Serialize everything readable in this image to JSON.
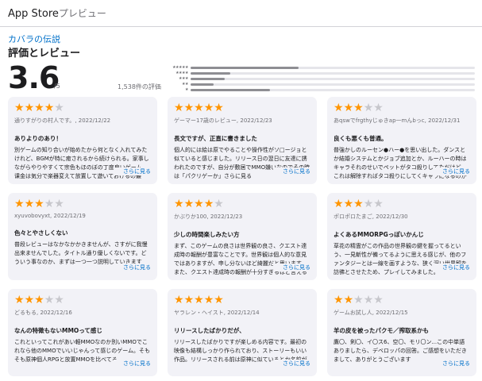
{
  "header": {
    "store": "App Store",
    "preview": "プレビュー"
  },
  "app": {
    "name": "カバラの伝説"
  },
  "ratings": {
    "section_title": "評価とレビュー",
    "score": "3.6",
    "out_of": "/5",
    "count": "1,538件の評価",
    "histogram": [
      {
        "stars": "★★★★★",
        "fraction": 0.38
      },
      {
        "stars": "★★★★",
        "fraction": 0.14
      },
      {
        "stars": "★★★",
        "fraction": 0.12
      },
      {
        "stars": "★★",
        "fraction": 0.08
      },
      {
        "stars": "★",
        "fraction": 0.28
      }
    ]
  },
  "reviews": [
    {
      "rating": 4,
      "author": "通りすがりの村人です。",
      "date": "2022/12/22",
      "title": "ありよりのあり！",
      "body": "別ゲームの知り合いが始めたから何となく入れてみたけれど、BGMが特に癒されるから続けられる。家事しながらやりやすくて宗色もほのぼの丁度良いゲーム。课金は気分で楽器変えて放置して遊いておけるの最高。",
      "more": "さらに見る"
    },
    {
      "rating": 5,
      "author": "ゲーマー17歳のレビュー",
      "date": "2022/12/23",
      "title": "長文ですが、正直に書きました",
      "body": "個人的には絵は原でやることや操作性がソ□ージョと似ていると感じました。リリース日の翌日に友達に誘われたのですが、自分が敷居でMMO嫌いなのでその時は「パクリゲーか」さらに見る",
      "more": "さらに見る"
    },
    {
      "rating": 3,
      "author": "あqswでfrgthyじゅきap一mんbっc",
      "date": "2022/12/31",
      "title": "良くも悪くも普通。",
      "body": "普強かしのルーセン●ハー●を思い出した。ダンスとか結婚システムとかジョブ追加とか、ルーハーの時はキャラそれのせいでペットがタコ殺りしてただけど、これは解除すればタコ殺りにしてくキャラになるのかな、きっと、わかり",
      "more": "さらに見る"
    },
    {
      "rating": 3,
      "author": "xyuvobovyxt",
      "date": "2022/12/19",
      "title": "色々とやさしくない",
      "body": "普段レビューはなかなかかきませんが、さすがに我慢出来ませんでした。タイトル通り優しくないです。どういう事なのか、まずは一つ一つ説明していきます",
      "more": "さらに見る"
    },
    {
      "rating": 4,
      "author": "かぶりか100",
      "date": "2022/12/23",
      "title": "少しの時間楽しみたい方",
      "body": "まず、このゲームの良さは世界観の良さ、クエスト達成時の報酬が豊富なことです。世界観は個人的な意見ではありますが、申し分ないほど綺麗だと思います。また、クエスト達成時の報酬が十分すぎるほど言えるということ",
      "more": "さらに見る"
    },
    {
      "rating": 3,
      "author": "ポロポロたまご",
      "date": "2022/12/30",
      "title": "よくあるMMORPGっぽいかんじ",
      "body": "草花の精霊がこの作品の世界観の鍵を握ってるという、一見斬性が備ってるように思える感じが、他のファンタジーとは一線を画すような、狭く深い世界観を訪彿とさせたため、プレイしてみました。",
      "more": "さらに見る"
    },
    {
      "rating": 3,
      "author": "どるもる",
      "date": "2022/12/16",
      "title": "なんの特徴もないMMOって感じ",
      "body": "これといってこれがあい軽MMOなのか別いMMOでこれなら他のMMOでいいじゃんって感じのゲーム。そもそも原神個人RPGと放置MMOを比べてる",
      "more": "さらに見る"
    },
    {
      "rating": 5,
      "author": "ヤラレン・ヘイスト",
      "date": "2022/12/14",
      "title": "リリースしたばかりだが、",
      "body": "リリースしたばかりですが楽しめる内容です。最初の映像も結構しっかり作られており、ストーリーもいい作品。リリースされる前は原神に似ているとか名前が",
      "more": "さらに見る"
    },
    {
      "rating": 2,
      "author": "ゲームお試し人",
      "date": "2022/12/15",
      "title": "羊の皮を被ったパクモ／搾取系かも",
      "body": "鷹〇、剣〇、イ〇ス6、空〇、モリ〇ン...この中単語ありましたら、デベロッパの回答。ご感想をいただきまして、ありがとうございます",
      "more": "さらに見る"
    }
  ],
  "colors": {
    "accent": "#0070c9",
    "star": "#ff9500",
    "card_bg": "#f2f2f7"
  }
}
